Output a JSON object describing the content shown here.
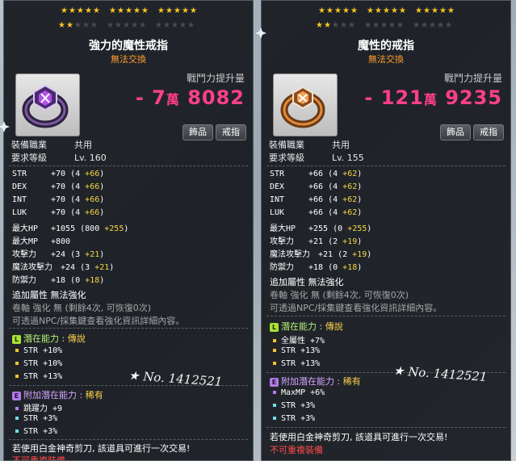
{
  "colors": {
    "cp_pink": "#ff3f8a",
    "bonus_yellow": "#f5d545",
    "trade_orange": "#ff9b2d",
    "legend_green": "#b7f27a",
    "epic_purple": "#d6a6ff"
  },
  "left": {
    "stars": {
      "row1_on": 15,
      "row1_total": 15,
      "row2_on": 2,
      "row2_total": 5
    },
    "name": "強力的魔性戒指",
    "trade": "無法交換",
    "cp_label": "戰鬥力提升量",
    "cp_prefix": "- 7",
    "cp_wan": "萬",
    "cp_rest": "8082",
    "tag1": "飾品",
    "tag2": "戒指",
    "job_label": "裝備職業",
    "job_value": "共用",
    "req_label": "要求等級",
    "req_value": "Lv. 160",
    "stats": [
      {
        "name": "STR",
        "base": "+70",
        "paren_open": "(4",
        "bonus": "+66",
        "paren_close": ")"
      },
      {
        "name": "DEX",
        "base": "+70",
        "paren_open": "(4",
        "bonus": "+66",
        "paren_close": ")"
      },
      {
        "name": "INT",
        "base": "+70",
        "paren_open": "(4",
        "bonus": "+66",
        "paren_close": ")"
      },
      {
        "name": "LUK",
        "base": "+70",
        "paren_open": "(4",
        "bonus": "+66",
        "paren_close": ")"
      },
      {
        "name": "最大HP",
        "base": "+1055",
        "paren_open": "(800",
        "bonus": "+255",
        "paren_close": ")"
      },
      {
        "name": "最大MP",
        "base": "+800",
        "paren_open": "",
        "bonus": "",
        "paren_close": ""
      },
      {
        "name": "攻擊力",
        "base": "+24",
        "paren_open": "(3",
        "bonus": "+21",
        "paren_close": ")"
      },
      {
        "name": "魔法攻擊力",
        "base": "+24",
        "paren_open": "(3",
        "bonus": "+21",
        "paren_close": ")"
      },
      {
        "name": "防禦力",
        "base": "+18",
        "paren_open": "(0",
        "bonus": "+18",
        "paren_close": ")"
      }
    ],
    "extra_attr": "追加屬性 無法強化",
    "scroll_info": "卷軸 強化 無 (剩餘4次, 可恢復0次)",
    "npc_info": "可透過NPC/採集鍵查看強化資訊詳細內容。",
    "potential": {
      "title": "潛在能力",
      "sep": ":",
      "grade": "傳說",
      "lines": [
        "STR +10%",
        "STR +10%",
        "STR +13%"
      ]
    },
    "add_potential": {
      "title": "附加潛在能力",
      "sep": ":",
      "grade": "稀有",
      "lines": [
        "跳躍力 +9",
        "STR +3%",
        "STR +3%"
      ]
    },
    "scissors": "若使用白金神奇剪刀, 該道具可進行一次交易!",
    "nonrepeat": "不可重複裝備",
    "watermark": "★ No. 1412521"
  },
  "right": {
    "stars": {
      "row1_on": 15,
      "row1_total": 15,
      "row2_on": 2,
      "row2_total": 5
    },
    "name": "魔性的戒指",
    "trade": "無法交換",
    "cp_label": "戰鬥力提升量",
    "cp_prefix": "- 121",
    "cp_wan": "萬",
    "cp_rest": "9235",
    "tag1": "飾品",
    "tag2": "戒指",
    "job_label": "裝備職業",
    "job_value": "共用",
    "req_label": "要求等級",
    "req_value": "Lv. 155",
    "stats": [
      {
        "name": "STR",
        "base": "+66",
        "paren_open": "(4",
        "bonus": "+62",
        "paren_close": ")"
      },
      {
        "name": "DEX",
        "base": "+66",
        "paren_open": "(4",
        "bonus": "+62",
        "paren_close": ")"
      },
      {
        "name": "INT",
        "base": "+66",
        "paren_open": "(4",
        "bonus": "+62",
        "paren_close": ")"
      },
      {
        "name": "LUK",
        "base": "+66",
        "paren_open": "(4",
        "bonus": "+62",
        "paren_close": ")"
      },
      {
        "name": "最大HP",
        "base": "+255",
        "paren_open": "(0",
        "bonus": "+255",
        "paren_close": ")"
      },
      {
        "name": "攻擊力",
        "base": "+21",
        "paren_open": "(2",
        "bonus": "+19",
        "paren_close": ")"
      },
      {
        "name": "魔法攻擊力",
        "base": "+21",
        "paren_open": "(2",
        "bonus": "+19",
        "paren_close": ")"
      },
      {
        "name": "防禦力",
        "base": "+18",
        "paren_open": "(0",
        "bonus": "+18",
        "paren_close": ")"
      }
    ],
    "extra_attr": "追加屬性 無法強化",
    "scroll_info": "卷軸 強化 無 (剩餘4次, 可恢復0次)",
    "npc_info": "可透過NPC/採集鍵查看強化資訊詳細內容。",
    "potential": {
      "title": "潛在能力",
      "sep": ":",
      "grade": "傳說",
      "lines": [
        "全屬性 +7%",
        "STR +13%",
        "STR +13%"
      ]
    },
    "add_potential": {
      "title": "附加潛在能力",
      "sep": ":",
      "grade": "稀有",
      "lines": [
        "MaxMP +6%",
        "STR +3%",
        "STR +3%"
      ]
    },
    "scissors": "若使用白金神奇剪刀, 該道具可進行一次交易!",
    "nonrepeat": "不可重複裝備",
    "watermark": "★ No. 1412521"
  }
}
